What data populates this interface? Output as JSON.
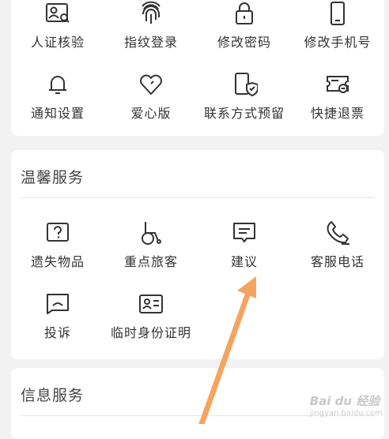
{
  "account_security": {
    "items": [
      {
        "label": "人证核验",
        "icon": "id-card-search-icon"
      },
      {
        "label": "指纹登录",
        "icon": "fingerprint-icon"
      },
      {
        "label": "修改密码",
        "icon": "lock-icon"
      },
      {
        "label": "修改手机号",
        "icon": "phone-icon"
      },
      {
        "label": "通知设置",
        "icon": "bell-icon"
      },
      {
        "label": "爱心版",
        "icon": "heart-icon"
      },
      {
        "label": "联系方式预留",
        "icon": "phone-shield-icon"
      },
      {
        "label": "快捷退票",
        "icon": "ticket-refund-icon"
      }
    ]
  },
  "warm_service": {
    "title": "温馨服务",
    "items": [
      {
        "label": "遗失物品",
        "icon": "lost-item-icon"
      },
      {
        "label": "重点旅客",
        "icon": "wheelchair-icon"
      },
      {
        "label": "建议",
        "icon": "suggestion-icon"
      },
      {
        "label": "客服电话",
        "icon": "phone-call-icon"
      },
      {
        "label": "投诉",
        "icon": "complaint-icon"
      },
      {
        "label": "临时身份证明",
        "icon": "temp-id-icon"
      }
    ]
  },
  "info_service": {
    "title": "信息服务"
  },
  "watermark": {
    "logo": "Bai du 经验",
    "sub": "jingyan.baidu.com"
  },
  "colors": {
    "background": "#f2f2f2",
    "card": "#ffffff",
    "icon_stroke": "#333333",
    "arrow": "#f4a460"
  }
}
